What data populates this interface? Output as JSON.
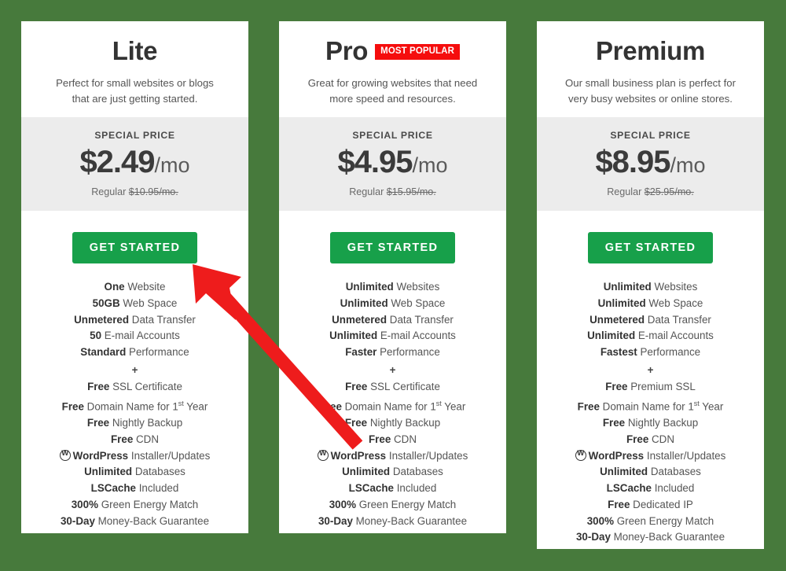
{
  "page": {
    "background_color": "#477A3C",
    "card_background": "#ffffff",
    "price_band_color": "#ECECEC",
    "cta_color": "#17A04A",
    "badge_color": "#F50D0D",
    "annotation_arrow_color": "#EE1C1C"
  },
  "plans": [
    {
      "name": "Lite",
      "badge": "",
      "description": "Perfect for small websites or blogs that are just getting started.",
      "special_price_label": "SPECIAL PRICE",
      "price_amount": "$2.49",
      "price_period": "/mo",
      "regular_prefix": "Regular ",
      "regular_price": "$10.95/mo.",
      "cta_label": "GET STARTED",
      "features": [
        {
          "strong": "One",
          "rest": " Website"
        },
        {
          "strong": "50GB",
          "rest": " Web Space"
        },
        {
          "strong": "Unmetered",
          "rest": " Data Transfer"
        },
        {
          "strong": "50",
          "rest": " E-mail Accounts"
        },
        {
          "strong": "Standard",
          "rest": " Performance"
        },
        {
          "separator": "+"
        },
        {
          "strong": "Free",
          "rest": " SSL Certificate"
        },
        {
          "strong": "Free",
          "rest": " Domain Name for 1",
          "ordinal": "st",
          "tail": " Year"
        },
        {
          "strong": "Free",
          "rest": " Nightly Backup"
        },
        {
          "strong": "Free",
          "rest": " CDN"
        },
        {
          "icon": "wordpress-icon",
          "strong": "WordPress",
          "rest": " Installer/Updates"
        },
        {
          "strong": "Unlimited",
          "rest": " Databases"
        },
        {
          "strong": "LSCache",
          "rest": " Included"
        },
        {
          "strong": "300%",
          "rest": " Green Energy Match"
        },
        {
          "strong": "30-Day",
          "rest": " Money-Back Guarantee"
        }
      ]
    },
    {
      "name": "Pro",
      "badge": "MOST POPULAR",
      "description": "Great for growing websites that need more speed and resources.",
      "special_price_label": "SPECIAL PRICE",
      "price_amount": "$4.95",
      "price_period": "/mo",
      "regular_prefix": "Regular ",
      "regular_price": "$15.95/mo.",
      "cta_label": "GET STARTED",
      "features": [
        {
          "strong": "Unlimited",
          "rest": " Websites"
        },
        {
          "strong": "Unlimited",
          "rest": " Web Space"
        },
        {
          "strong": "Unmetered",
          "rest": " Data Transfer"
        },
        {
          "strong": "Unlimited",
          "rest": " E-mail Accounts"
        },
        {
          "strong": "Faster",
          "rest": " Performance"
        },
        {
          "separator": "+"
        },
        {
          "strong": "Free",
          "rest": " SSL Certificate"
        },
        {
          "strong": "Free",
          "rest": " Domain Name for 1",
          "ordinal": "st",
          "tail": " Year"
        },
        {
          "strong": "Free",
          "rest": " Nightly Backup"
        },
        {
          "strong": "Free",
          "rest": " CDN"
        },
        {
          "icon": "wordpress-icon",
          "strong": "WordPress",
          "rest": " Installer/Updates"
        },
        {
          "strong": "Unlimited",
          "rest": " Databases"
        },
        {
          "strong": "LSCache",
          "rest": " Included"
        },
        {
          "strong": "300%",
          "rest": " Green Energy Match"
        },
        {
          "strong": "30-Day",
          "rest": " Money-Back Guarantee"
        }
      ]
    },
    {
      "name": "Premium",
      "badge": "",
      "description": "Our small business plan is perfect for very busy websites or online stores.",
      "special_price_label": "SPECIAL PRICE",
      "price_amount": "$8.95",
      "price_period": "/mo",
      "regular_prefix": "Regular ",
      "regular_price": "$25.95/mo.",
      "cta_label": "GET STARTED",
      "features": [
        {
          "strong": "Unlimited",
          "rest": " Websites"
        },
        {
          "strong": "Unlimited",
          "rest": " Web Space"
        },
        {
          "strong": "Unmetered",
          "rest": " Data Transfer"
        },
        {
          "strong": "Unlimited",
          "rest": " E-mail Accounts"
        },
        {
          "strong": "Fastest",
          "rest": " Performance"
        },
        {
          "separator": "+"
        },
        {
          "strong": "Free",
          "rest": " Premium SSL"
        },
        {
          "strong": "Free",
          "rest": " Domain Name for 1",
          "ordinal": "st",
          "tail": " Year"
        },
        {
          "strong": "Free",
          "rest": " Nightly Backup"
        },
        {
          "strong": "Free",
          "rest": " CDN"
        },
        {
          "icon": "wordpress-icon",
          "strong": "WordPress",
          "rest": " Installer/Updates"
        },
        {
          "strong": "Unlimited",
          "rest": " Databases"
        },
        {
          "strong": "LSCache",
          "rest": " Included"
        },
        {
          "strong": "Free",
          "rest": " Dedicated IP"
        },
        {
          "strong": "300%",
          "rest": " Green Energy Match"
        },
        {
          "strong": "30-Day",
          "rest": " Money-Back Guarantee"
        }
      ]
    }
  ]
}
